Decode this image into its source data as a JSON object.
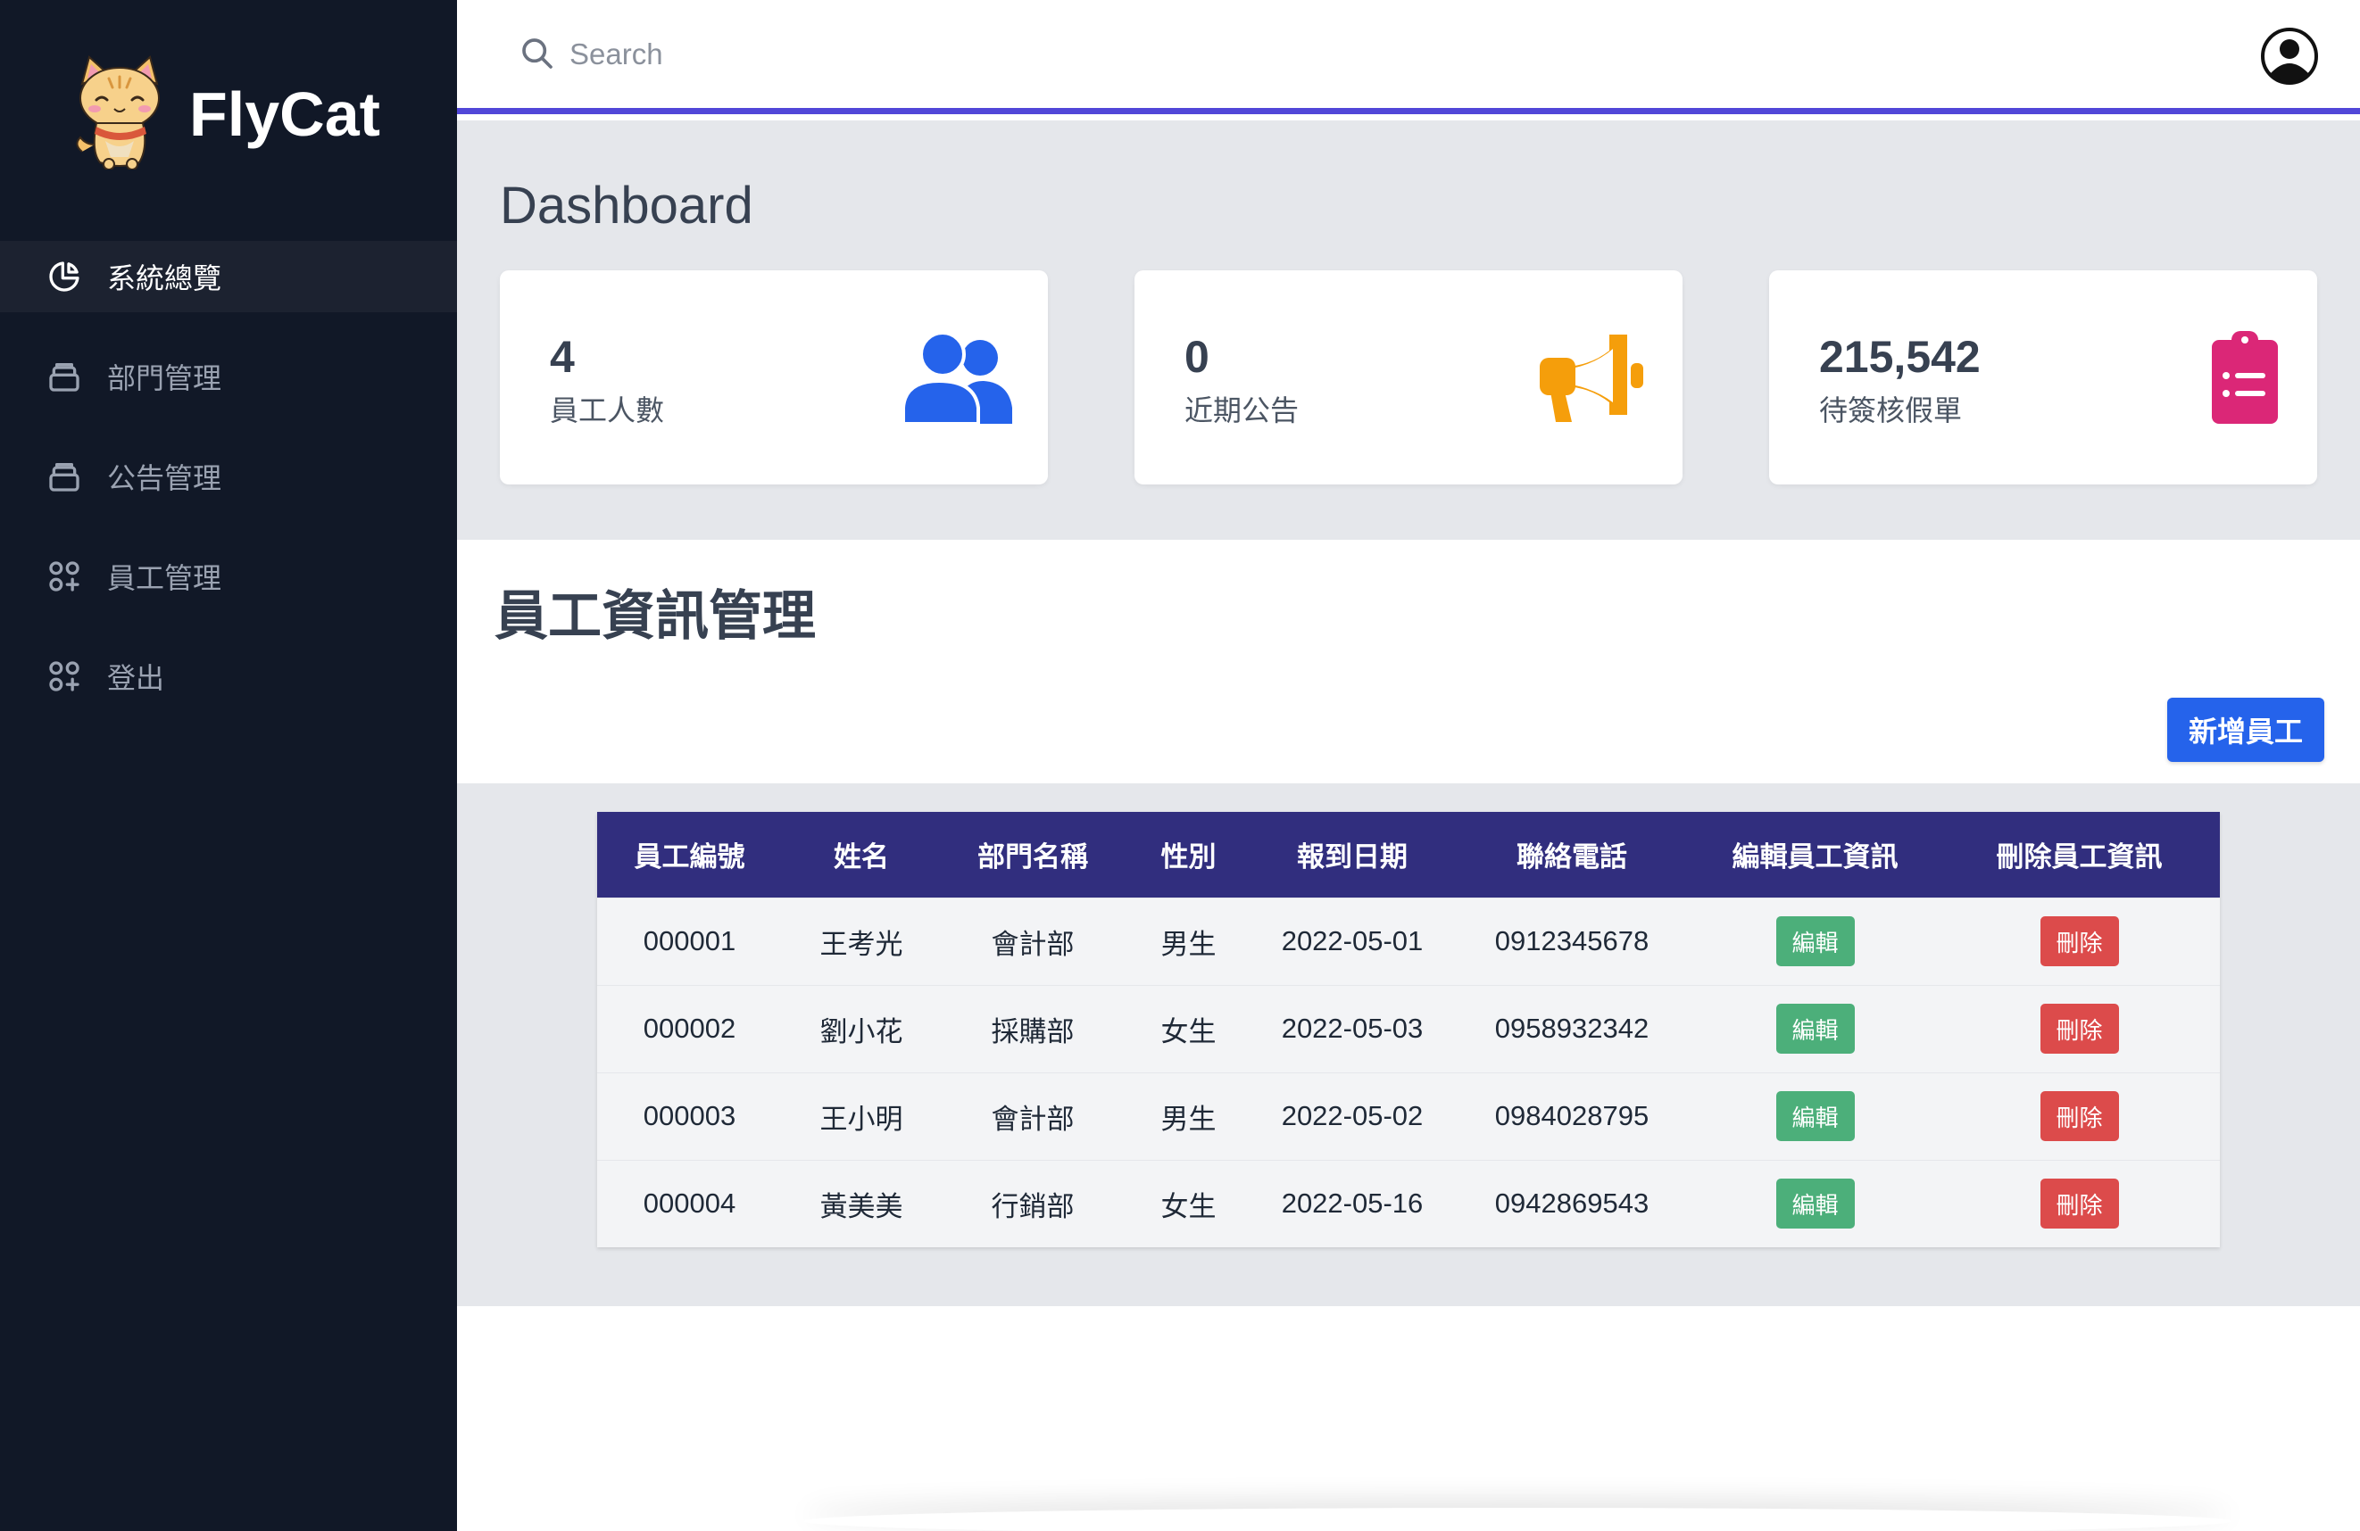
{
  "brand": {
    "name": "FlyCat",
    "logo_icon": "cat-logo"
  },
  "sidebar": {
    "items": [
      {
        "label": "系統總覽",
        "icon": "pie-chart-icon",
        "active": true
      },
      {
        "label": "部門管理",
        "icon": "archive-icon",
        "active": false
      },
      {
        "label": "公告管理",
        "icon": "archive-icon",
        "active": false
      },
      {
        "label": "員工管理",
        "icon": "grid-plus-icon",
        "active": false
      },
      {
        "label": "登出",
        "icon": "grid-plus-icon",
        "active": false
      }
    ]
  },
  "topbar": {
    "search_placeholder": "Search",
    "accent": "#5147d8"
  },
  "dashboard": {
    "title": "Dashboard",
    "cards": [
      {
        "value": "4",
        "label": "員工人數",
        "icon": "users-icon",
        "color": "#2563eb"
      },
      {
        "value": "0",
        "label": "近期公告",
        "icon": "megaphone-icon",
        "color": "#f59e0b"
      },
      {
        "value": "215,542",
        "label": "待簽核假單",
        "icon": "clipboard-list-icon",
        "color": "#db2777"
      }
    ]
  },
  "employees": {
    "title": "員工資訊管理",
    "add_label": "新增員工",
    "columns": [
      "員工編號",
      "姓名",
      "部門名稱",
      "性別",
      "報到日期",
      "聯絡電話",
      "編輯員工資訊",
      "刪除員工資訊"
    ],
    "edit_label": "編輯",
    "delete_label": "刪除",
    "rows": [
      {
        "id": "000001",
        "name": "王考光",
        "dept": "會計部",
        "gender": "男生",
        "date": "2022-05-01",
        "phone": "0912345678"
      },
      {
        "id": "000002",
        "name": "劉小花",
        "dept": "採購部",
        "gender": "女生",
        "date": "2022-05-03",
        "phone": "0958932342"
      },
      {
        "id": "000003",
        "name": "王小明",
        "dept": "會計部",
        "gender": "男生",
        "date": "2022-05-02",
        "phone": "0984028795"
      },
      {
        "id": "000004",
        "name": "黃美美",
        "dept": "行銷部",
        "gender": "女生",
        "date": "2022-05-16",
        "phone": "0942869543"
      }
    ]
  }
}
